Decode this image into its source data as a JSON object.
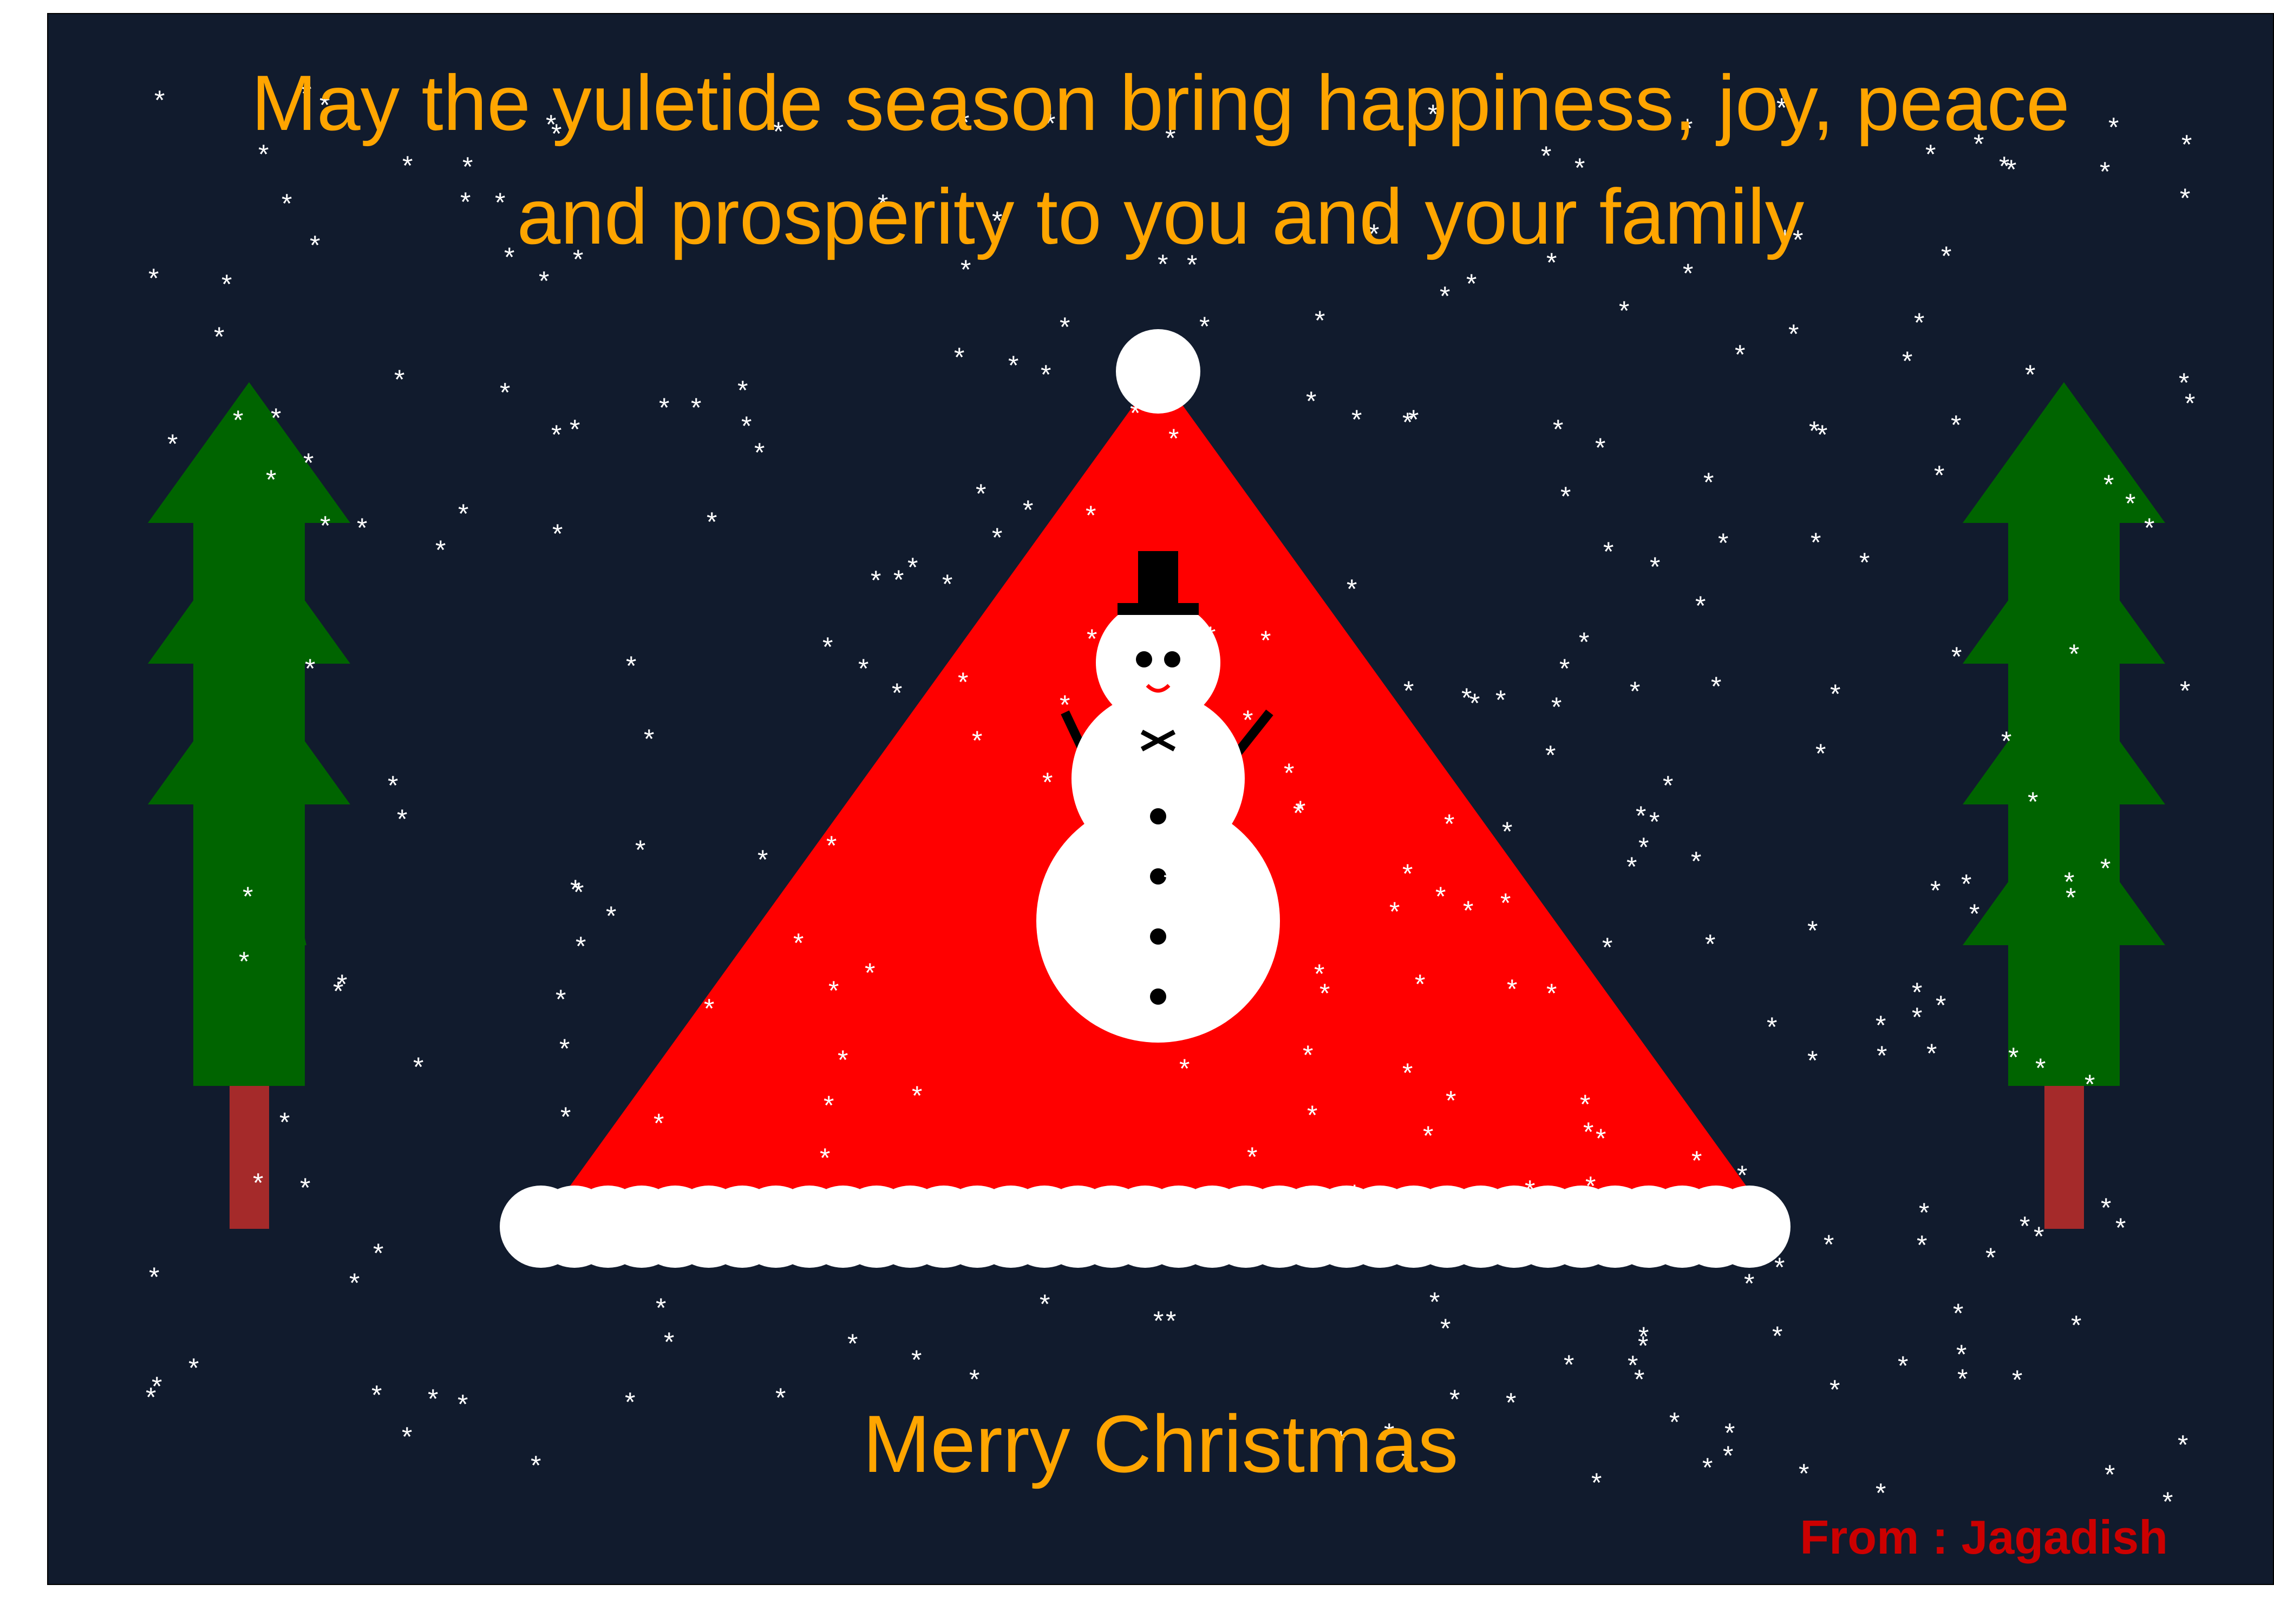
{
  "card": {
    "line1": "May the yuletide season bring happiness, joy, peace",
    "line2": "and prosperity to you and your family",
    "merry": "Merry Christmas",
    "from": "From : Jagadish"
  },
  "snow_glyph": "*",
  "colors": {
    "background": "#111b2d",
    "greeting_text": "#ffa500",
    "from_text": "#cc0000",
    "hat_red": "#ff0000",
    "white": "#ffffff",
    "tree_green": "#006400",
    "trunk": "#a52a2a",
    "black": "#000000",
    "smile": "#ff0000"
  }
}
